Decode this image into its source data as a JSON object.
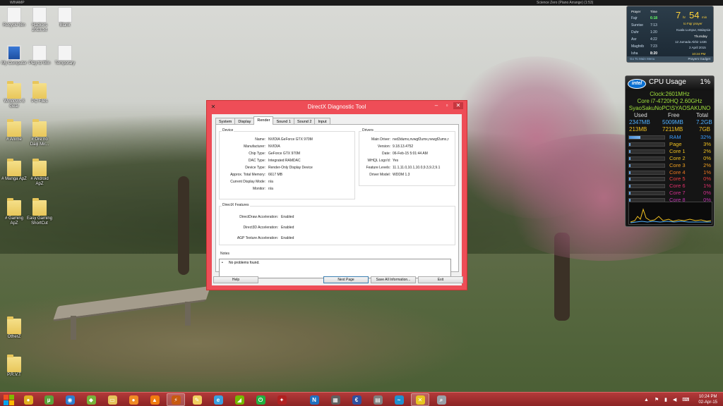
{
  "topbar": {
    "app_title": "WINAMP",
    "song": "Science Zero (Piano Arrange) (1:53)"
  },
  "desktop_icons": [
    {
      "label": "Recycle Bin"
    },
    {
      "label": "Hackers 2013.txt"
    },
    {
      "label": "Blank"
    },
    {
      "label": "My Computer"
    },
    {
      "label": "Play to Win"
    },
    {
      "label": "Temporary"
    },
    {
      "label": "Windows 8 Gear"
    },
    {
      "label": "PC Files"
    },
    {
      "label": "# Anime"
    },
    {
      "label": "# Ore no Daiji Mir..."
    },
    {
      "label": "# Manga ApZ"
    },
    {
      "label": "# Android ApZ"
    },
    {
      "label": "# Gaming ApZ"
    },
    {
      "label": "Easy Gaming ShortCut"
    },
    {
      "label": "OtherZ"
    },
    {
      "label": "P.R.V.T"
    }
  ],
  "dxdiag": {
    "title": "DirectX Diagnostic Tool",
    "tabs": [
      "System",
      "Display",
      "Render",
      "Sound 1",
      "Sound 2",
      "Input"
    ],
    "active_tab": "Render",
    "device_group": "Device",
    "device": [
      {
        "k": "Name:",
        "v": "NVIDIA GeForce GTX 970M"
      },
      {
        "k": "Manufacturer:",
        "v": "NVIDIA"
      },
      {
        "k": "Chip Type:",
        "v": "GeForce GTX 970M"
      },
      {
        "k": "DAC Type:",
        "v": "Integrated RAMDAC"
      },
      {
        "k": "Device Type:",
        "v": "Render-Only Display Device"
      },
      {
        "k": "Approx. Total Memory:",
        "v": "6617 MB"
      },
      {
        "k": "Current Display Mode:",
        "v": "n/a"
      },
      {
        "k": "Monitor:",
        "v": "n/a"
      }
    ],
    "drivers_group": "Drivers",
    "drivers": [
      {
        "k": "Main Driver:",
        "v": "nvd3dumx,nvwgf2umx,nvwgf2umx,r"
      },
      {
        "k": "Version:",
        "v": "9.18.13.4752"
      },
      {
        "k": "Date:",
        "v": "06-Feb-15 5:01:44 AM"
      },
      {
        "k": "WHQL Logo'd:",
        "v": "Yes"
      },
      {
        "k": "Feature Levels:",
        "v": "11.1,11.0,10.1,10.0,9.3,9.2,9.1"
      },
      {
        "k": "Driver Model:",
        "v": "WDDM 1.3"
      }
    ],
    "features_group": "DirectX Features",
    "features": [
      {
        "k": "DirectDraw Acceleration:",
        "v": "Enabled"
      },
      {
        "k": "Direct3D Acceleration:",
        "v": "Enabled"
      },
      {
        "k": "AGP Texture Acceleration:",
        "v": "Enabled"
      }
    ],
    "notes_group": "Notes",
    "notes": "No problems found.",
    "buttons": {
      "help": "Help",
      "next": "Next Page",
      "save": "Save All Information...",
      "exit": "Exit"
    }
  },
  "prayer": {
    "col_prayer": "Prayer",
    "col_time": "Time",
    "rows": [
      {
        "name": "Fajr",
        "time": "6:18"
      },
      {
        "name": "Sunrise",
        "time": "7:13"
      },
      {
        "name": "Duhr",
        "time": "1:20"
      },
      {
        "name": "Asr",
        "time": "4:22"
      },
      {
        "name": "Maghrib",
        "time": "7:23"
      },
      {
        "name": "Isha",
        "time": "8:20"
      }
    ],
    "countdown_hr": "7",
    "hr_unit": "hr",
    "countdown_min": "54",
    "min_unit": "min",
    "countdown_label": "to Fajr prayer",
    "city": "Kuala Lumpur, Malaysia",
    "day": "Thursday",
    "hijri": "12 Jumada Akhir 1436",
    "date": "2 April 2015",
    "time": "10:24 PM",
    "footer_left": "Go To Main Menu",
    "footer_right": "Prayers Gadget"
  },
  "cpu": {
    "title": "CPU Usage",
    "usage": "1%",
    "clock": "Clock:2601MHz",
    "model": "Core i7-4720HQ 2.60GHz",
    "host": "SyaoSakuNoPC\\SYAOSAKUNO",
    "mem_headers": [
      "Used",
      "Free",
      "Total"
    ],
    "mem_ram": [
      "2347MB",
      "5009MB",
      "7.2GB"
    ],
    "mem_page": [
      "213MB",
      "7211MB",
      "7GB"
    ],
    "bars": [
      {
        "label": "RAM",
        "value": "32%",
        "fraction": 0.32,
        "color": "#3b9dff"
      },
      {
        "label": "Page",
        "value": "3%",
        "fraction": 0.03,
        "color": "#f0c020"
      },
      {
        "label": "Core 1",
        "value": "2%",
        "fraction": 0.02,
        "color": "#f0c020"
      },
      {
        "label": "Core 2",
        "value": "0%",
        "fraction": 0.0,
        "color": "#f0c020"
      },
      {
        "label": "Core 3",
        "value": "2%",
        "fraction": 0.02,
        "color": "#f0a020"
      },
      {
        "label": "Core 4",
        "value": "1%",
        "fraction": 0.01,
        "color": "#f07820"
      },
      {
        "label": "Core 5",
        "value": "0%",
        "fraction": 0.0,
        "color": "#ee4040"
      },
      {
        "label": "Core 6",
        "value": "1%",
        "fraction": 0.01,
        "color": "#e0306a"
      },
      {
        "label": "Core 7",
        "value": "0%",
        "fraction": 0.0,
        "color": "#d53090"
      },
      {
        "label": "Core 8",
        "value": "0%",
        "fraction": 0.0,
        "color": "#c030b0"
      }
    ]
  },
  "taskbar": {
    "apps": [
      {
        "name": "chrome-icon",
        "color": "#e0b020",
        "glyph": "●"
      },
      {
        "name": "utorrent-icon",
        "color": "#5aa33a",
        "glyph": "µ"
      },
      {
        "name": "globe-icon",
        "color": "#2f7fd0",
        "glyph": "◉"
      },
      {
        "name": "android-icon",
        "color": "#78b33a",
        "glyph": "◆"
      },
      {
        "name": "folder-icon",
        "color": "#e5c25a",
        "glyph": "▭"
      },
      {
        "name": "chat-icon",
        "color": "#f08a24",
        "glyph": "●"
      },
      {
        "name": "vlc-icon",
        "color": "#f07c10",
        "glyph": "▲"
      },
      {
        "name": "winamp-icon",
        "color": "#c85a10",
        "glyph": "⚡"
      },
      {
        "name": "notes-icon",
        "color": "#f2d060",
        "glyph": "✎"
      },
      {
        "name": "browser-icon",
        "color": "#3aa0e0",
        "glyph": "e"
      },
      {
        "name": "nvidia-icon",
        "color": "#76b900",
        "glyph": "◢"
      },
      {
        "name": "power-icon",
        "color": "#20b040",
        "glyph": "⏻"
      },
      {
        "name": "dragon-icon",
        "color": "#b02020",
        "glyph": "✦"
      },
      {
        "name": "n-app-icon",
        "color": "#2070c0",
        "glyph": "N"
      },
      {
        "name": "calculator-icon",
        "color": "#606060",
        "glyph": "▦"
      },
      {
        "name": "e-app-icon",
        "color": "#3050a0",
        "glyph": "€"
      },
      {
        "name": "network-icon",
        "color": "#808080",
        "glyph": "▤"
      },
      {
        "name": "bird-icon",
        "color": "#2090d0",
        "glyph": "~"
      },
      {
        "name": "directx-icon",
        "color": "#e8c420",
        "glyph": "✕"
      },
      {
        "name": "magnify-icon",
        "color": "#9aa0a8",
        "glyph": "⌕"
      }
    ],
    "clock_time": "10:24 PM",
    "clock_date": "02-Apr-15"
  }
}
